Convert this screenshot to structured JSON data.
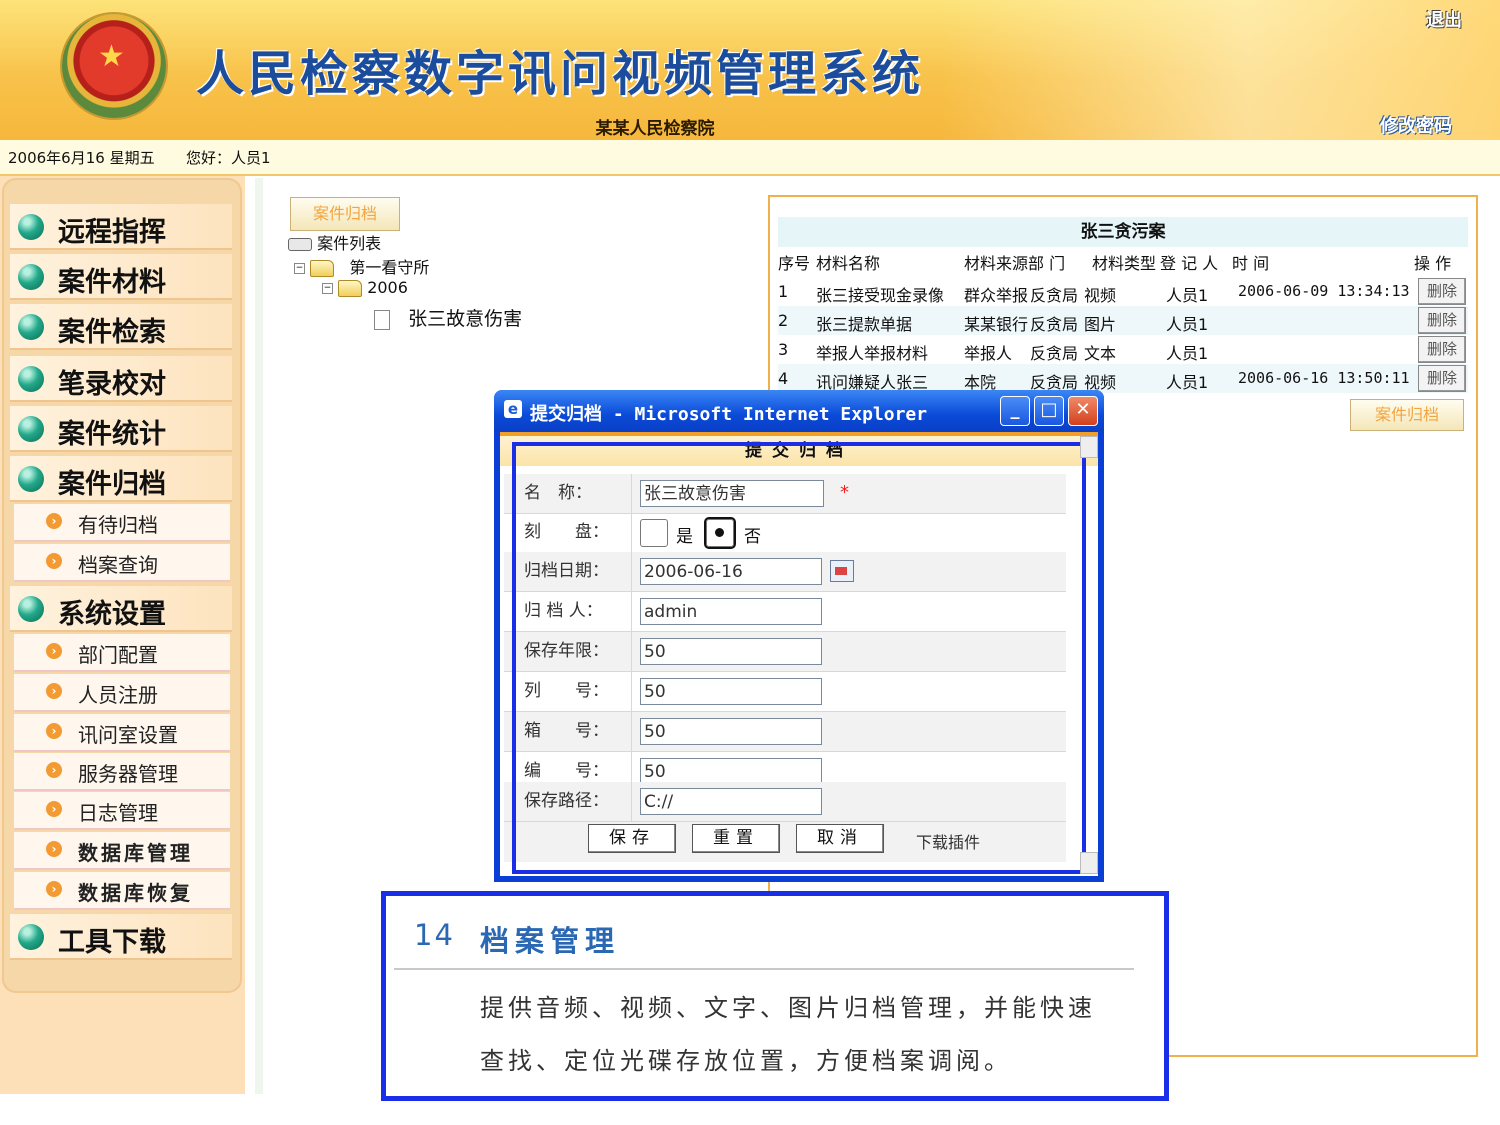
{
  "header": {
    "title": "人民检察数字讯问视频管理系统",
    "org": "某某人民检察院",
    "logout": "退出",
    "change_password": "修改密码",
    "date": "2006年6月16 星期五",
    "greeting": "您好：人员1"
  },
  "sidebar": {
    "menu": [
      {
        "label": "远程指挥"
      },
      {
        "label": "案件材料"
      },
      {
        "label": "案件检索"
      },
      {
        "label": "笔录校对"
      },
      {
        "label": "案件统计"
      },
      {
        "label": "案件归档"
      },
      {
        "label": "系统设置"
      },
      {
        "label": "工具下载"
      }
    ],
    "archive_sub": [
      "有待归档",
      "档案查询"
    ],
    "settings_sub": [
      "部门配置",
      "人员注册",
      "讯问室设置",
      "服务器管理",
      "日志管理",
      "数据库管理",
      "数据库恢复"
    ]
  },
  "tree": {
    "button": "案件归档",
    "root": "案件列表",
    "node1": "第一看守所",
    "node2": "2006",
    "leaf": "张三故意伤害"
  },
  "table": {
    "title": "张三贪污案",
    "headers": [
      "序号",
      "材料名称",
      "材料来源部 门",
      "材料类型",
      "登 记 人",
      "时 间",
      "操 作"
    ],
    "rows": [
      {
        "no": "1",
        "name": "张三接受现金录像",
        "source": "群众举报",
        "dept": "反贪局",
        "type": "视频",
        "person": "人员1",
        "time": "2006-06-09 13:34:13",
        "action": "删除"
      },
      {
        "no": "2",
        "name": "张三提款单据",
        "source": "某某银行",
        "dept": "反贪局",
        "type": "图片",
        "person": "人员1",
        "time": "",
        "action": "删除"
      },
      {
        "no": "3",
        "name": "举报人举报材料",
        "source": "举报人",
        "dept": "反贪局",
        "type": "文本",
        "person": "人员1",
        "time": "",
        "action": "删除"
      },
      {
        "no": "4",
        "name": "讯问嫌疑人张三",
        "source": "本院",
        "dept": "反贪局",
        "type": "视频",
        "person": "人员1",
        "time": "2006-06-16 13:50:11",
        "action": "删除"
      }
    ],
    "archive_button": "案件归档"
  },
  "dialog": {
    "window_title": "提交归档 - Microsoft Internet Explorer",
    "form_title": "提交归档",
    "fields": [
      {
        "label": "名　称：",
        "value": "张三故意伤害"
      },
      {
        "label": "刻　　盘：",
        "yes": "是",
        "no": "否",
        "selected": "否"
      },
      {
        "label": "归档日期：",
        "value": "2006-06-16"
      },
      {
        "label": "归 档 人：",
        "value": "admin"
      },
      {
        "label": "保存年限：",
        "value": "50"
      },
      {
        "label": "列　　号：",
        "value": "50"
      },
      {
        "label": "箱　　号：",
        "value": "50"
      },
      {
        "label": "编　　号：",
        "value": "50"
      },
      {
        "label": "保存路径：",
        "value": "C://"
      }
    ],
    "required_mark": "*",
    "buttons": {
      "save": "保存",
      "reset": "重置",
      "cancel": "取消",
      "download": "下载插件"
    }
  },
  "note": {
    "number": "14",
    "heading": "档案管理",
    "line1": "提供音频、视频、文字、图片归档管理，并能快速",
    "line2": "查找、定位光碟存放位置，方便档案调阅。"
  }
}
